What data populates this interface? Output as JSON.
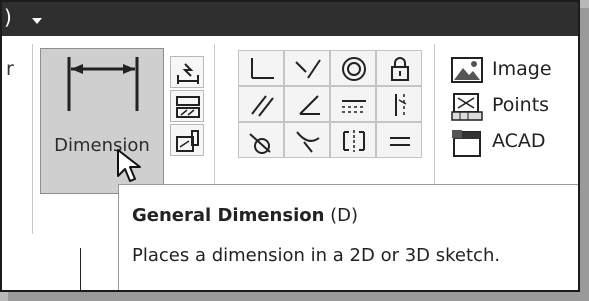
{
  "titlebar": {
    "fragment": ")"
  },
  "ribbon": {
    "prev_panel_label": "r",
    "dimension": {
      "label": "Dimension"
    },
    "insert": {
      "items": [
        {
          "label": "Image",
          "icon": "image-icon"
        },
        {
          "label": "Points",
          "icon": "points-icon"
        },
        {
          "label": "ACAD",
          "icon": "acad-icon"
        }
      ]
    }
  },
  "tooltip": {
    "title": "General Dimension",
    "shortcut": "(D)",
    "description": "Places a dimension in a 2D or 3D sketch."
  }
}
